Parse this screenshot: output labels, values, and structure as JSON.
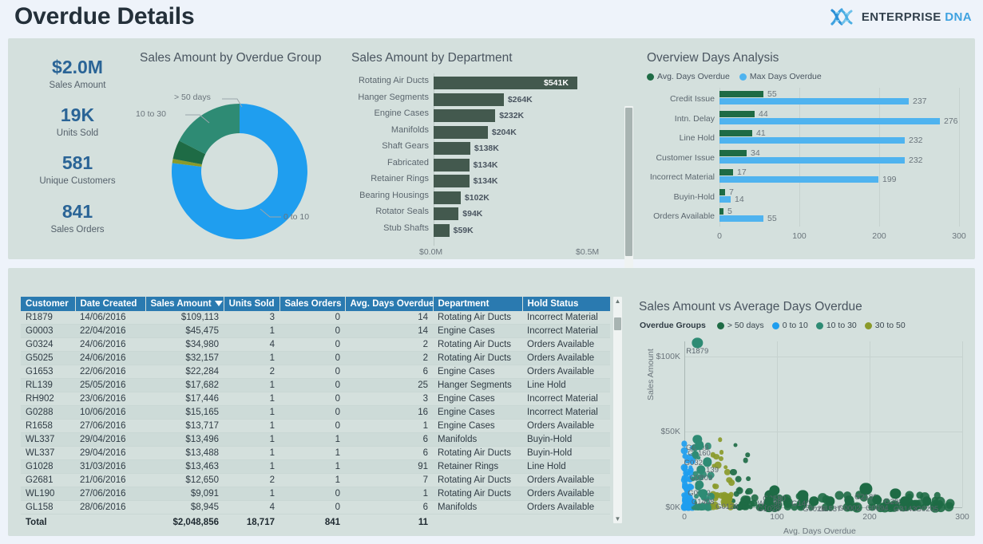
{
  "header": {
    "title": "Overdue Details",
    "brand_primary": "ENTERPRISE",
    "brand_secondary": "DNA",
    "brand_icon": "dna-helix-icon"
  },
  "theme": {
    "page_bg": "#eef3fa",
    "panel_bg": "#d4e0dd",
    "kpi_value": "#2a6496",
    "table_header_bg": "#2a7ab0",
    "dark_green": "#1e6b45",
    "bar_green": "#43594e",
    "bright_blue": "#1f9eef",
    "light_blue": "#4fb3ef",
    "teal": "#2e8b74",
    "olive": "#8a9a2a"
  },
  "kpis": [
    {
      "value": "$2.0M",
      "label": "Sales Amount"
    },
    {
      "value": "19K",
      "label": "Units Sold"
    },
    {
      "value": "581",
      "label": "Unique Customers"
    },
    {
      "value": "841",
      "label": "Sales Orders"
    }
  ],
  "chart_data": [
    {
      "id": "donut",
      "type": "pie",
      "title": "Sales Amount by Overdue Group",
      "xlabel": "",
      "ylabel": "",
      "legend": "callouts",
      "categories": [
        "0 to 10",
        "10 to 30",
        "> 50 days",
        "30 to 50"
      ],
      "values": [
        77,
        17.5,
        4.5,
        1
      ],
      "colors": [
        "#1f9eef",
        "#2e8b74",
        "#1e6b45",
        "#8a9a2a"
      ],
      "callouts": [
        "> 50 days",
        "10 to 30",
        "0 to 10"
      ]
    },
    {
      "id": "department",
      "type": "bar",
      "orientation": "horizontal",
      "title": "Sales Amount by Department",
      "xlabel": "",
      "ylabel": "",
      "grid": false,
      "xlim": [
        0,
        0.5
      ],
      "xticks": [
        "$0.0M",
        "$0.5M"
      ],
      "categories": [
        "Rotating Air Ducts",
        "Hanger Segments",
        "Engine Cases",
        "Manifolds",
        "Shaft Gears",
        "Fabricated",
        "Retainer Rings",
        "Bearing Housings",
        "Rotator Seals",
        "Stub Shafts"
      ],
      "values": [
        541,
        264,
        232,
        204,
        138,
        134,
        134,
        102,
        94,
        59
      ],
      "labels": [
        "$541K",
        "$264K",
        "$232K",
        "$204K",
        "$138K",
        "$134K",
        "$134K",
        "$102K",
        "$94K",
        "$59K"
      ],
      "color": "#43594e"
    },
    {
      "id": "overview-days",
      "type": "bar",
      "orientation": "horizontal",
      "title": "Overview Days Analysis",
      "xlabel": "",
      "ylabel": "",
      "xlim": [
        0,
        300
      ],
      "xticks": [
        "0",
        "100",
        "200",
        "300"
      ],
      "grid": true,
      "legend_position": "top-left",
      "categories": [
        "Credit Issue",
        "Intn. Delay",
        "Line Hold",
        "Customer Issue",
        "Incorrect Material",
        "Buyin-Hold",
        "Orders Available"
      ],
      "series": [
        {
          "name": "Avg. Days Overdue",
          "color": "#1e6b45",
          "values": [
            55,
            44,
            41,
            34,
            17,
            7,
            5
          ]
        },
        {
          "name": "Max Days Overdue",
          "color": "#4fb3ef",
          "values": [
            237,
            276,
            232,
            232,
            199,
            14,
            55
          ]
        }
      ]
    },
    {
      "id": "scatter",
      "type": "scatter",
      "title": "Sales Amount vs Average Days Overdue",
      "xlabel": "Avg. Days Overdue",
      "ylabel": "Sales Amount",
      "xlim": [
        0,
        300
      ],
      "ylim": [
        0,
        110
      ],
      "xticks": [
        "0",
        "100",
        "200",
        "300"
      ],
      "yticks": [
        "$0K",
        "$50K",
        "$100K"
      ],
      "grid": true,
      "legend_title": "Overdue Groups",
      "legend": [
        {
          "name": "> 50 days",
          "color": "#1e6b45"
        },
        {
          "name": "0 to 10",
          "color": "#1f9eef"
        },
        {
          "name": "10 to 30",
          "color": "#2e8b74"
        },
        {
          "name": "30 to 50",
          "color": "#8a9a2a"
        }
      ],
      "points": [
        {
          "label": "R1879",
          "x": 14,
          "y": 109,
          "group": "10 to 30",
          "r": 7
        },
        {
          "label": "G0003",
          "x": 14,
          "y": 45,
          "group": "10 to 30",
          "r": 6
        },
        {
          "label": "GL160",
          "x": 16,
          "y": 41,
          "group": "10 to 30",
          "r": 6
        },
        {
          "label": "G0324",
          "x": 12,
          "y": 35,
          "group": "10 to 30",
          "r": 5
        },
        {
          "label": "RL139",
          "x": 25,
          "y": 30,
          "group": "10 to 30",
          "r": 6
        },
        {
          "label": "G0803",
          "x": 18,
          "y": 25,
          "group": "10 to 30",
          "r": 6
        },
        {
          "label": "G0002",
          "x": 16,
          "y": 15,
          "group": "10 to 30",
          "r": 6
        },
        {
          "label": "G1408",
          "x": 20,
          "y": 9,
          "group": "10 to 30",
          "r": 6
        },
        {
          "label": "G0126",
          "x": 46,
          "y": 6,
          "group": "30 to 50",
          "r": 7
        },
        {
          "label": "WL198",
          "x": 92,
          "y": 8,
          "group": "> 50 days",
          "r": 7
        },
        {
          "label": "G2580",
          "x": 97,
          "y": 11,
          "group": "> 50 days",
          "r": 7
        },
        {
          "label": "G1028",
          "x": 91,
          "y": 4,
          "group": "> 50 days",
          "r": 6
        },
        {
          "label": "G1408",
          "x": 128,
          "y": 8,
          "group": "> 50 days",
          "r": 7
        },
        {
          "label": "G0026",
          "x": 140,
          "y": 4,
          "group": "> 50 days",
          "r": 6
        },
        {
          "label": "G1537",
          "x": 157,
          "y": 4,
          "group": "> 50 days",
          "r": 6
        },
        {
          "label": "G0002",
          "x": 178,
          "y": 5,
          "group": "> 50 days",
          "r": 6
        },
        {
          "label": "G2189",
          "x": 196,
          "y": 12,
          "group": "> 50 days",
          "r": 8
        },
        {
          "label": "G0094",
          "x": 208,
          "y": 5,
          "group": "> 50 days",
          "r": 6
        },
        {
          "label": "G2986",
          "x": 228,
          "y": 9,
          "group": "> 50 days",
          "r": 7
        },
        {
          "label": "G3143",
          "x": 238,
          "y": 4,
          "group": "> 50 days",
          "r": 6
        },
        {
          "label": "G0205",
          "x": 262,
          "y": 4,
          "group": "> 50 days",
          "r": 6
        }
      ]
    }
  ],
  "table": {
    "columns": [
      {
        "key": "customer",
        "label": "Customer",
        "align": "left"
      },
      {
        "key": "date_created",
        "label": "Date Created",
        "align": "left"
      },
      {
        "key": "sales_amount",
        "label": "Sales Amount",
        "align": "right",
        "sorted": "desc"
      },
      {
        "key": "units_sold",
        "label": "Units Sold",
        "align": "right"
      },
      {
        "key": "sales_orders",
        "label": "Sales Orders",
        "align": "right"
      },
      {
        "key": "avg_days_overdue",
        "label": "Avg. Days Overdue",
        "align": "right"
      },
      {
        "key": "department",
        "label": "Department",
        "align": "left"
      },
      {
        "key": "hold_status",
        "label": "Hold Status",
        "align": "left"
      }
    ],
    "rows": [
      [
        "R1879",
        "14/06/2016",
        "$109,113",
        "3",
        "0",
        "14",
        "Rotating Air Ducts",
        "Incorrect Material"
      ],
      [
        "G0003",
        "22/04/2016",
        "$45,475",
        "1",
        "0",
        "14",
        "Engine Cases",
        "Incorrect Material"
      ],
      [
        "G0324",
        "24/06/2016",
        "$34,980",
        "4",
        "0",
        "2",
        "Rotating Air Ducts",
        "Orders Available"
      ],
      [
        "G5025",
        "24/06/2016",
        "$32,157",
        "1",
        "0",
        "2",
        "Rotating Air Ducts",
        "Orders Available"
      ],
      [
        "G1653",
        "22/06/2016",
        "$22,284",
        "2",
        "0",
        "6",
        "Engine Cases",
        "Orders Available"
      ],
      [
        "RL139",
        "25/05/2016",
        "$17,682",
        "1",
        "0",
        "25",
        "Hanger Segments",
        "Line Hold"
      ],
      [
        "RH902",
        "23/06/2016",
        "$17,446",
        "1",
        "0",
        "3",
        "Engine Cases",
        "Incorrect Material"
      ],
      [
        "G0288",
        "10/06/2016",
        "$15,165",
        "1",
        "0",
        "16",
        "Engine Cases",
        "Incorrect Material"
      ],
      [
        "R1658",
        "27/06/2016",
        "$13,717",
        "1",
        "0",
        "1",
        "Engine Cases",
        "Orders Available"
      ],
      [
        "WL337",
        "29/04/2016",
        "$13,496",
        "1",
        "1",
        "6",
        "Manifolds",
        "Buyin-Hold"
      ],
      [
        "WL337",
        "29/04/2016",
        "$13,488",
        "1",
        "1",
        "6",
        "Rotating Air Ducts",
        "Buyin-Hold"
      ],
      [
        "G1028",
        "31/03/2016",
        "$13,463",
        "1",
        "1",
        "91",
        "Retainer Rings",
        "Line Hold"
      ],
      [
        "G2681",
        "21/06/2016",
        "$12,650",
        "2",
        "1",
        "7",
        "Rotating Air Ducts",
        "Orders Available"
      ],
      [
        "WL190",
        "27/06/2016",
        "$9,091",
        "1",
        "0",
        "1",
        "Rotating Air Ducts",
        "Orders Available"
      ],
      [
        "GL158",
        "28/06/2016",
        "$8,945",
        "4",
        "0",
        "6",
        "Manifolds",
        "Orders Available"
      ]
    ],
    "total": [
      "Total",
      "",
      "$2,048,856",
      "18,717",
      "841",
      "11",
      "",
      ""
    ]
  }
}
